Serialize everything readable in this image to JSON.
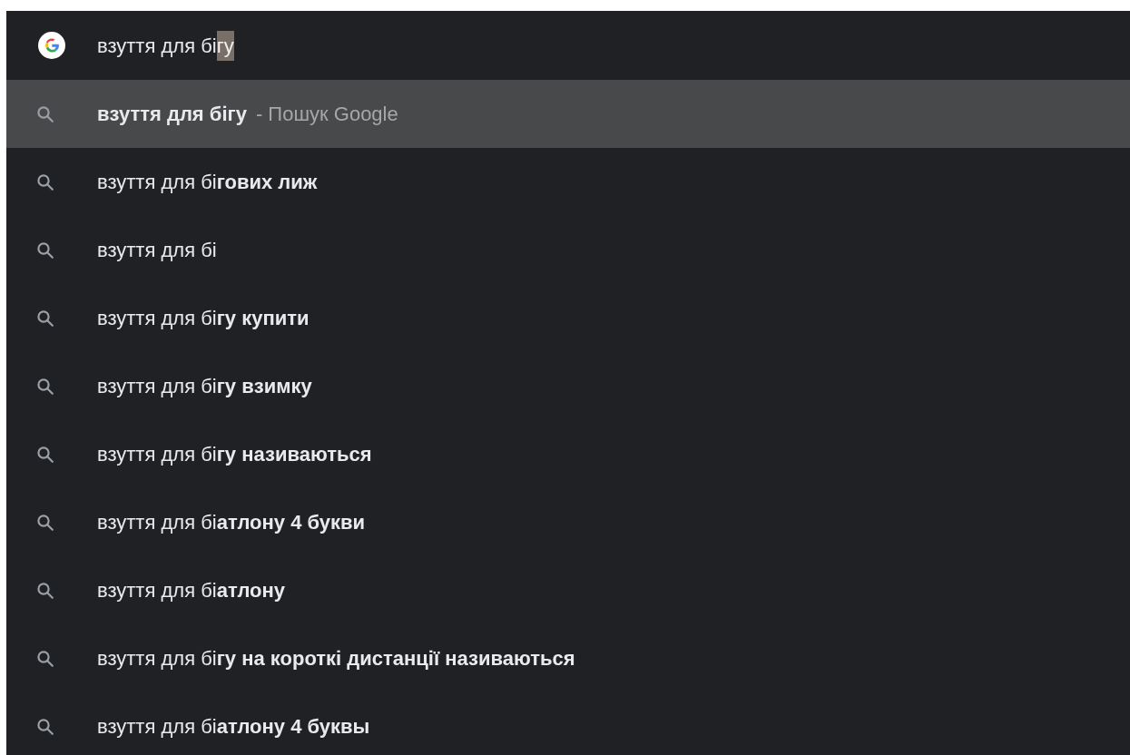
{
  "omnibox": {
    "value": "взуття для бі",
    "completion": "гу"
  },
  "suggestions": [
    {
      "text": "**взуття для бігу**",
      "source": "- Пошук Google",
      "selected": true
    },
    {
      "text": "взуття для бі**гових лиж**",
      "selected": false
    },
    {
      "text": "взуття для бі",
      "selected": false
    },
    {
      "text": "взуття для бі**гу купити**",
      "selected": false
    },
    {
      "text": "взуття для бі**гу взимку**",
      "selected": false
    },
    {
      "text": "взуття для бі**гу називаються**",
      "selected": false
    },
    {
      "text": "взуття для бі**атлону 4 букви**",
      "selected": false
    },
    {
      "text": "взуття для бі**атлону**",
      "selected": false
    },
    {
      "text": "взуття для бі**гу на короткі дистанції називаються**",
      "selected": false
    },
    {
      "text": "взуття для бі**атлону 4 буквы**",
      "selected": false
    }
  ]
}
